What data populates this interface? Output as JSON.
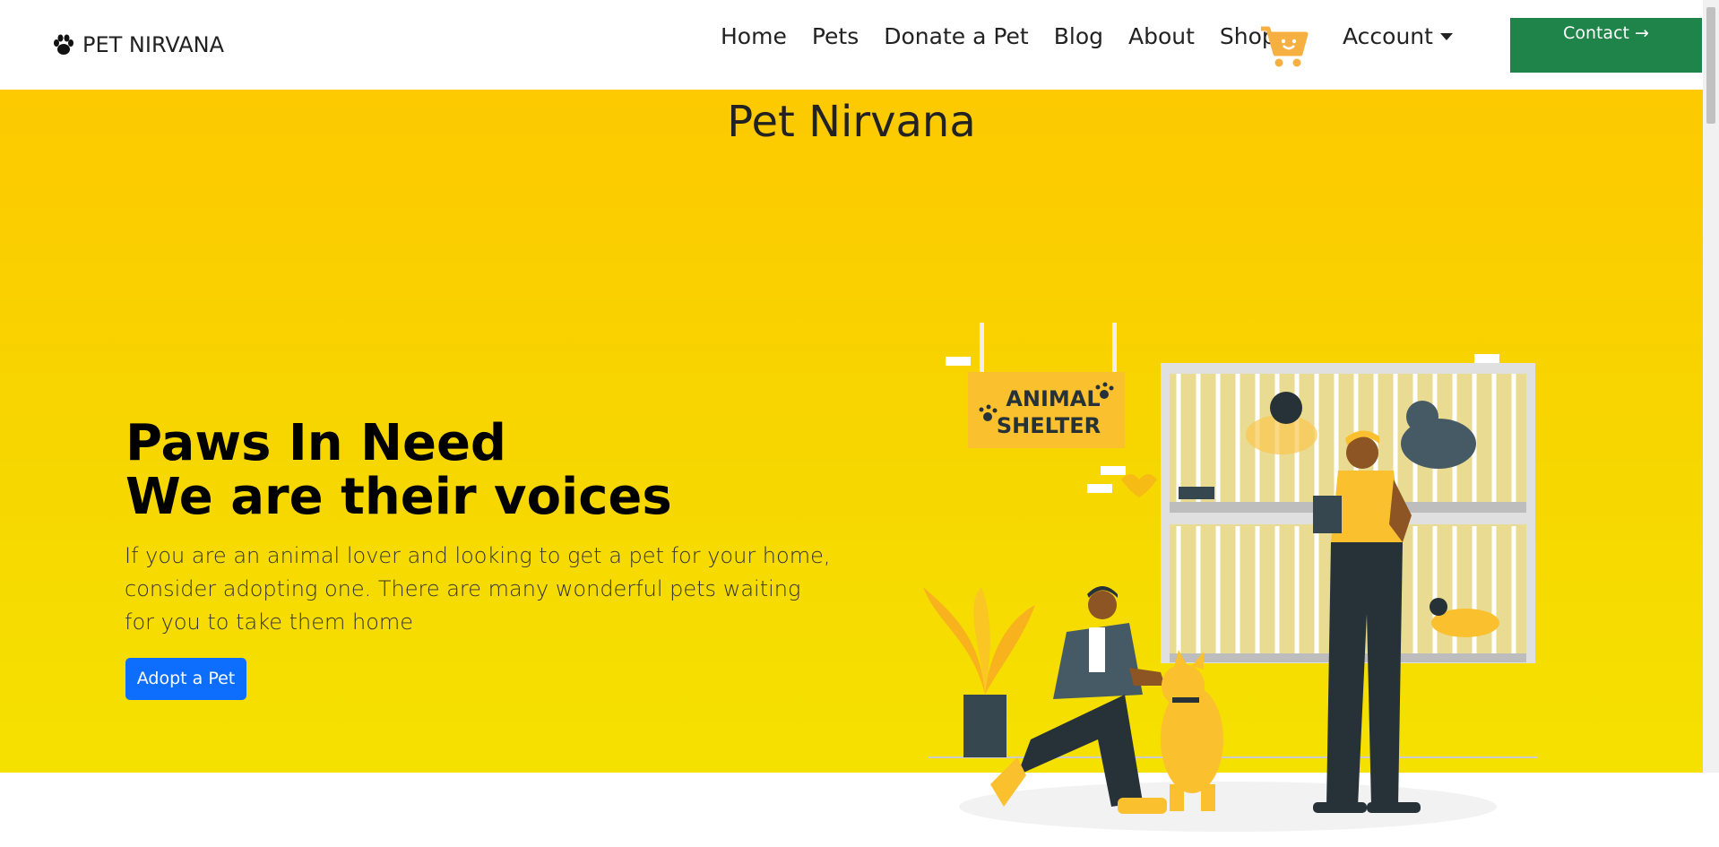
{
  "brand": {
    "name": "PET NIRVANA",
    "icon": "paw-icon"
  },
  "nav": {
    "links": [
      "Home",
      "Pets",
      "Donate a Pet",
      "Blog",
      "About",
      "Shop"
    ],
    "cart_icon": "cart-icon",
    "account_label": "Account",
    "contact_label": "Contact →"
  },
  "hero": {
    "title": "Pet Nirvana",
    "headline_line1": "Paws In Need",
    "headline_line2": "We are their voices",
    "description": "If you are an animal lover and looking to get a pet for your home, consider adopting one. There are many wonderful pets waiting for you to take them home",
    "cta_label": "Adopt a Pet",
    "sign_line1": "ANIMAL",
    "sign_line2": "SHELTER"
  },
  "colors": {
    "accent_yellow": "#fdc900",
    "contact_green": "#1e8449",
    "cta_blue": "#0d6efd",
    "cart_orange": "#f5b041"
  }
}
